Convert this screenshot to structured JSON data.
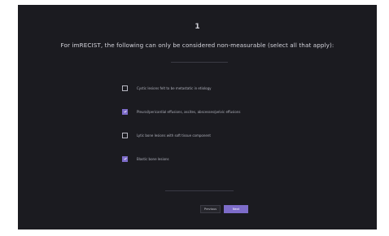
{
  "question": {
    "number": "1",
    "text": "For imRECIST, the following can only be considered non-measurable (select all that apply):"
  },
  "options": [
    {
      "label": "Cystic lesions felt to be metastatic in etiology",
      "checked": false
    },
    {
      "label": "Pleural/pericardial effusions, ascites, abscesses/pelvic effusions",
      "checked": true
    },
    {
      "label": "Lytic bone lesions with soft tissue component",
      "checked": false
    },
    {
      "label": "Blastic bone lesions",
      "checked": true
    }
  ],
  "buttons": {
    "previous_label": "Previous",
    "next_label": "Next"
  },
  "colors": {
    "background": "#1b1b20",
    "accent": "#7d6cc9"
  }
}
